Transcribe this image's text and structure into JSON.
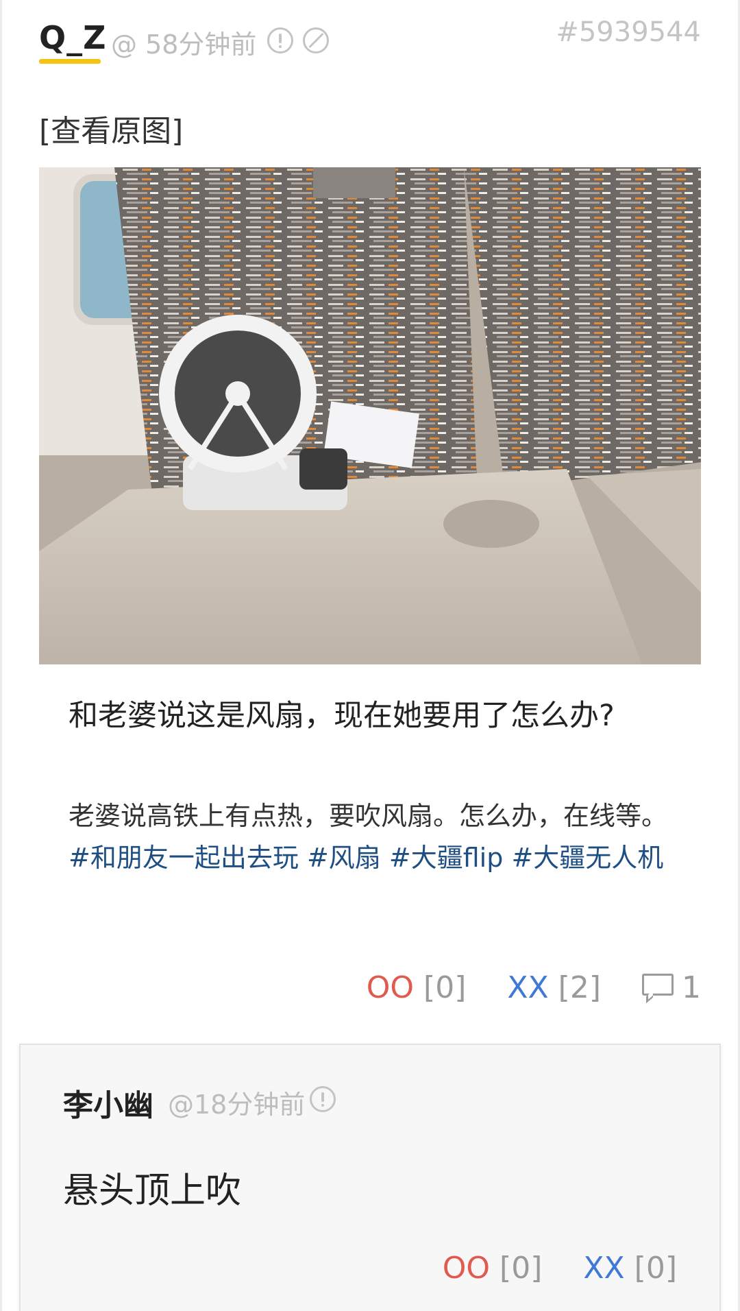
{
  "post": {
    "author": "Q_Z",
    "meta": "@ 58分钟前",
    "id": "#5939544",
    "view_original": "[查看原图]",
    "title": "和老婆说这是风扇，现在她要用了怎么办?",
    "body_text": "老婆说高铁上有点热，要吹风扇。怎么办，在线等。",
    "tags": [
      "#和朋友一起出去玩",
      "#风扇",
      "#大疆flip",
      "#大疆无人机"
    ],
    "votes": {
      "oo_label": "OO",
      "oo_count": "[0]",
      "xx_label": "XX",
      "xx_count": "[2]",
      "comment_count": "1"
    }
  },
  "reply": {
    "author": "李小幽",
    "meta": "@18分钟前",
    "text": "悬头顶上吹",
    "votes": {
      "oo_label": "OO",
      "oo_count": "[0]",
      "xx_label": "XX",
      "xx_count": "[0]"
    }
  },
  "icons": {
    "report": "exclamation-circle-icon",
    "block": "slash-circle-icon",
    "comment": "comment-bubble-icon"
  },
  "colors": {
    "author_underline": "#f3c316",
    "oo": "#e05a4e",
    "xx": "#3f78d6",
    "tag": "#1f4f82"
  }
}
